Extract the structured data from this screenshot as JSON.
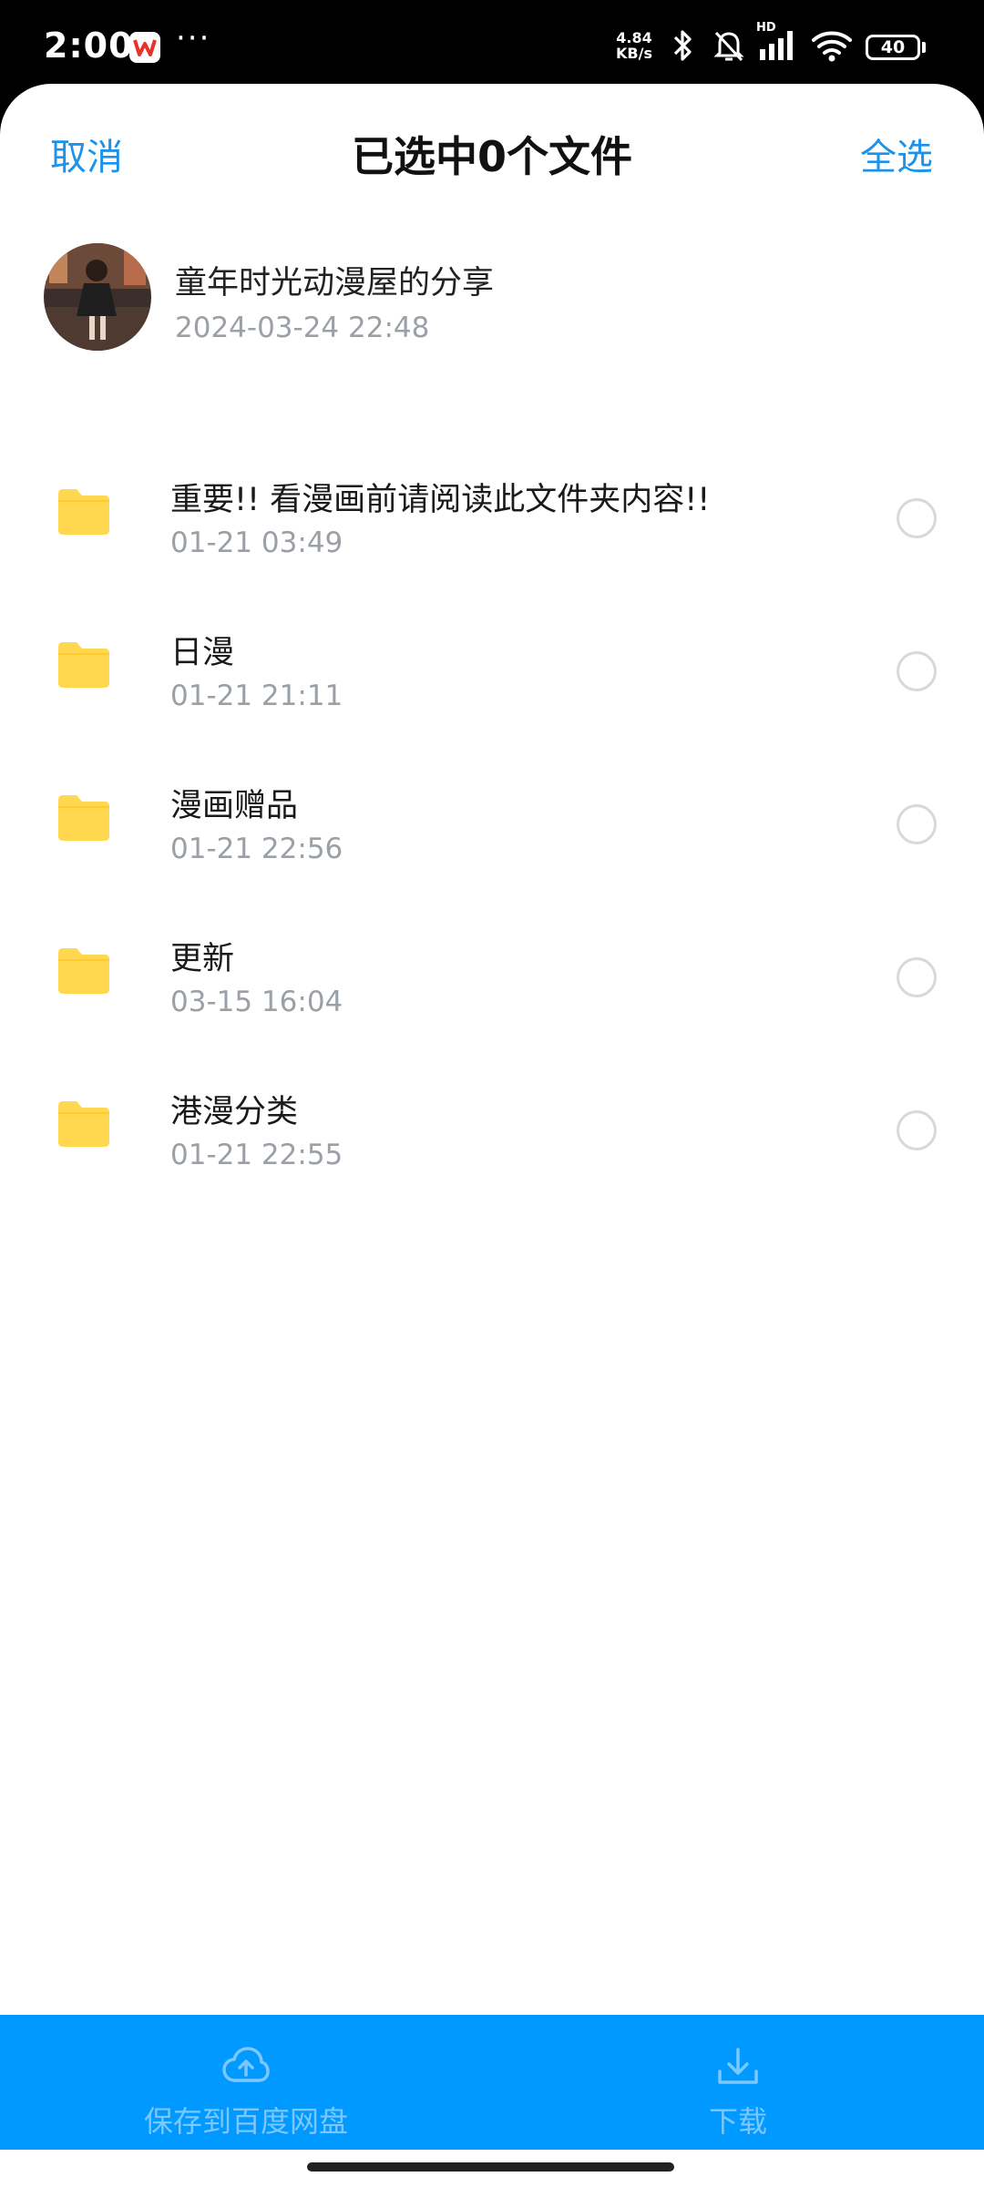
{
  "status_bar": {
    "time": "2:00",
    "dots": "···",
    "net_speed_value": "4.84",
    "net_speed_unit": "KB/s",
    "hd_label": "HD",
    "battery": "40",
    "icons": [
      "wps-app-icon",
      "bluetooth-icon",
      "bell-muted-icon",
      "signal-icon",
      "wifi-icon",
      "battery-icon"
    ]
  },
  "header": {
    "cancel_label": "取消",
    "title": "已选中0个文件",
    "select_all_label": "全选"
  },
  "sharer": {
    "name": "童年时光动漫屋的分享",
    "time": "2024-03-24  22:48"
  },
  "files": [
    {
      "name": "重要!! 看漫画前请阅读此文件夹内容!!",
      "time": "01-21  03:49",
      "selected": false
    },
    {
      "name": "日漫",
      "time": "01-21  21:11",
      "selected": false
    },
    {
      "name": "漫画赠品",
      "time": "01-21  22:56",
      "selected": false
    },
    {
      "name": "更新",
      "time": "03-15  16:04",
      "selected": false
    },
    {
      "name": "港漫分类",
      "time": "01-21  22:55",
      "selected": false
    }
  ],
  "bottom_bar": {
    "save_label": "保存到百度网盘",
    "download_label": "下载"
  },
  "colors": {
    "accent": "#1b93ea",
    "bottom_bar": "#0099ff",
    "folder": "#ffd84f",
    "secondary_text": "#9aa0a6"
  }
}
